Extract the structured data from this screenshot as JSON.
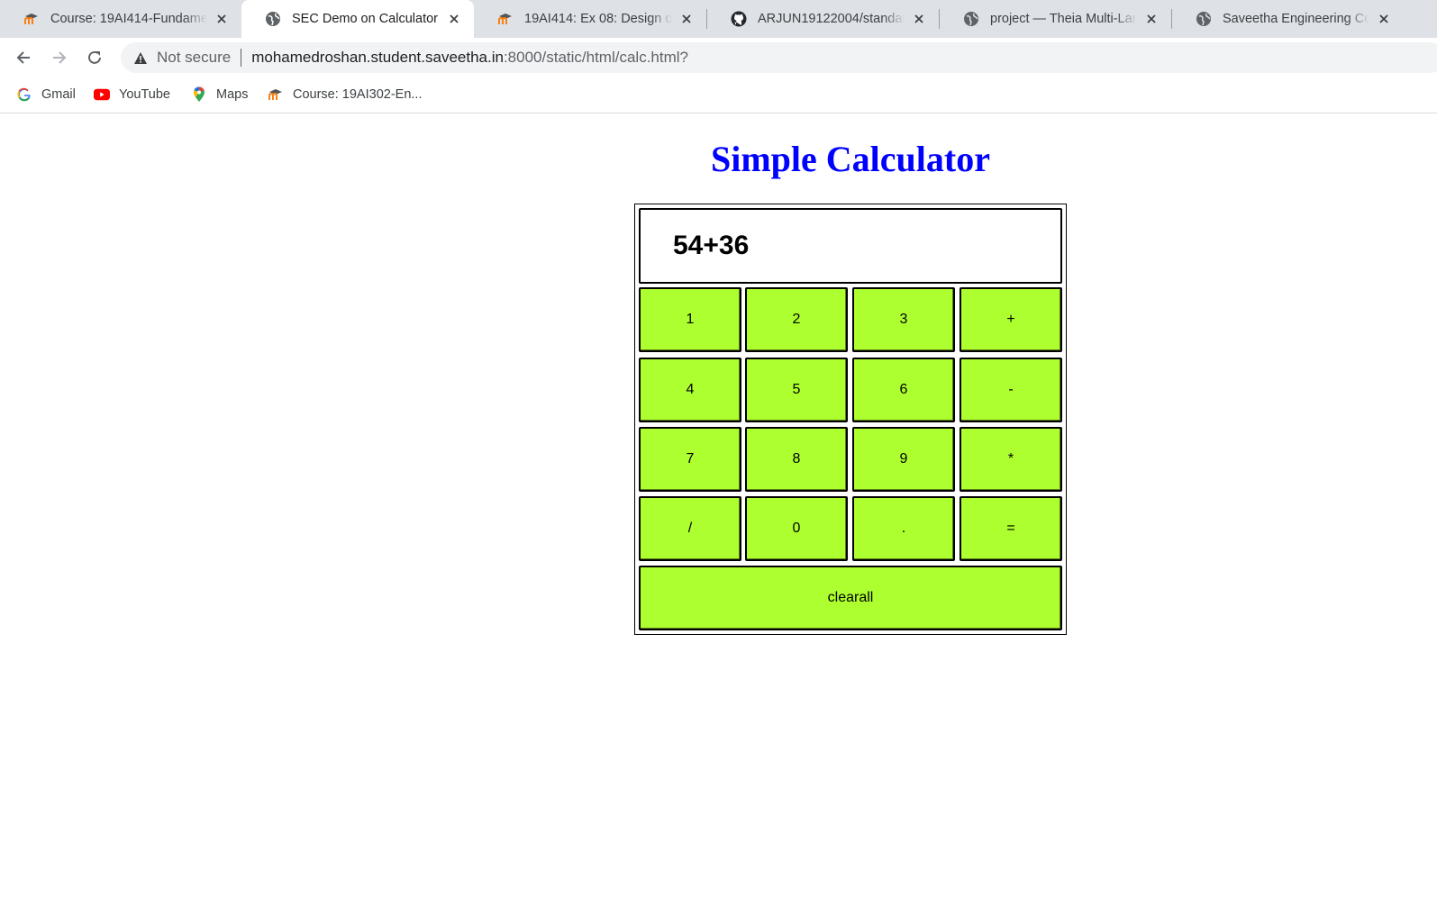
{
  "browser": {
    "tabs": [
      {
        "title": "Course: 19AI414-Fundamentals",
        "icon": "moodle-icon",
        "active": false
      },
      {
        "title": "SEC Demo on Calculator",
        "icon": "globe-icon",
        "active": true
      },
      {
        "title": "19AI414: Ex 08: Design of a",
        "icon": "moodle-icon",
        "active": false
      },
      {
        "title": "ARJUN19122004/standard-",
        "icon": "github-icon",
        "active": false
      },
      {
        "title": "project — Theia Multi-Language",
        "icon": "globe-icon",
        "active": false
      },
      {
        "title": "Saveetha Engineering College",
        "icon": "globe-icon",
        "active": false
      }
    ],
    "security_label": "Not secure",
    "url_host": "mohamedroshan.student.saveetha.in",
    "url_rest": ":8000/static/html/calc.html?",
    "bookmarks": [
      {
        "label": "Gmail",
        "icon": "google-icon"
      },
      {
        "label": "YouTube",
        "icon": "youtube-icon"
      },
      {
        "label": "Maps",
        "icon": "maps-pin-icon"
      },
      {
        "label": "Course: 19AI302-En...",
        "icon": "moodle-icon"
      }
    ]
  },
  "page": {
    "title": "Simple Calculator",
    "title_color": "#0000ff",
    "display_value": "54+36",
    "button_color": "#adff2f",
    "keys": [
      [
        "1",
        "2",
        "3",
        "+"
      ],
      [
        "4",
        "5",
        "6",
        "-"
      ],
      [
        "7",
        "8",
        "9",
        "*"
      ],
      [
        "/",
        "0",
        ".",
        "="
      ]
    ],
    "clear_label": "clearall"
  }
}
